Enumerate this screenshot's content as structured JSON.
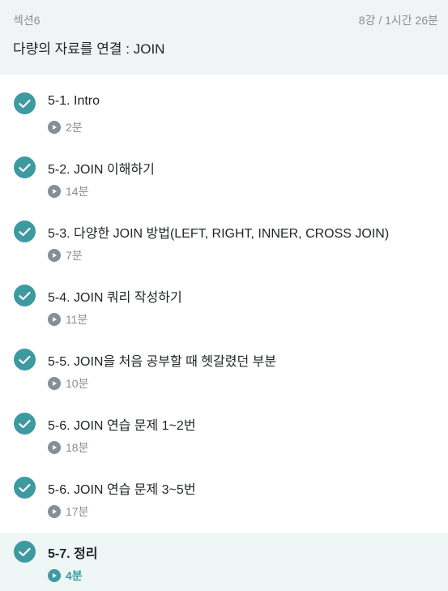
{
  "section": {
    "label": "섹션6",
    "meta": "8강 / 1시간 26분",
    "title": "다량의 자료를 연결 : JOIN"
  },
  "colors": {
    "accent": "#3d9aa0",
    "header_bg": "#f1f3f5",
    "active_bg": "#eef6f6",
    "muted": "#868e96"
  },
  "lectures": [
    {
      "title": "5-1. Intro",
      "duration": "2분",
      "completed": true,
      "active": false
    },
    {
      "title": "5-2. JOIN 이해하기",
      "duration": "14분",
      "completed": true,
      "active": false
    },
    {
      "title": "5-3. 다양한 JOIN 방법(LEFT, RIGHT, INNER, CROSS JOIN)",
      "duration": "7분",
      "completed": true,
      "active": false
    },
    {
      "title": "5-4. JOIN 쿼리 작성하기",
      "duration": "11분",
      "completed": true,
      "active": false
    },
    {
      "title": "5-5. JOIN을 처음 공부할 때 헷갈렸던 부분",
      "duration": "10분",
      "completed": true,
      "active": false
    },
    {
      "title": "5-6. JOIN 연습 문제 1~2번",
      "duration": "18분",
      "completed": true,
      "active": false
    },
    {
      "title": "5-6. JOIN 연습 문제 3~5번",
      "duration": "17분",
      "completed": true,
      "active": false
    },
    {
      "title": "5-7. 정리",
      "duration": "4분",
      "completed": true,
      "active": true
    }
  ],
  "icons": {
    "completed": "check-circle-icon",
    "play": "play-circle-icon"
  }
}
